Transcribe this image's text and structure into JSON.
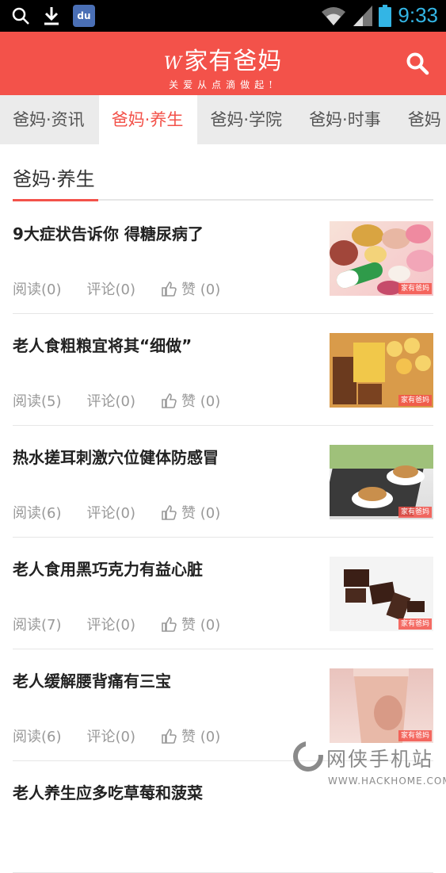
{
  "status_bar": {
    "time": "9:33",
    "left_icons": [
      "search-icon",
      "download-icon",
      "baidu-app-icon"
    ],
    "baidu_label": "du",
    "right_icons": [
      "wifi-icon",
      "signal-icon",
      "battery-icon"
    ],
    "time_color": "#33b5e5"
  },
  "header": {
    "brand_prefix": "W",
    "brand_name": "家有爸妈",
    "slogan": "关爱从点滴做起!",
    "background_color": "#f3524a",
    "search_icon": "search-icon"
  },
  "tabs": [
    {
      "label": "爸妈·资讯",
      "active": false
    },
    {
      "label": "爸妈·养生",
      "active": true
    },
    {
      "label": "爸妈·学院",
      "active": false
    },
    {
      "label": "爸妈·时事",
      "active": false
    },
    {
      "label": "爸妈",
      "active": false
    }
  ],
  "section": {
    "title": "爸妈·养生"
  },
  "articles": [
    {
      "title": "9大症状告诉你 得糖尿病了",
      "reads": "阅读(0)",
      "comments": "评论(0)",
      "likes": "赞 (0)",
      "thumb_watermark": "家有爸妈"
    },
    {
      "title": "老人食粗粮宜将其“细做”",
      "reads": "阅读(5)",
      "comments": "评论(0)",
      "likes": "赞 (0)",
      "thumb_watermark": "家有爸妈"
    },
    {
      "title": "热水搓耳刺激穴位健体防感冒",
      "reads": "阅读(6)",
      "comments": "评论(0)",
      "likes": "赞 (0)",
      "thumb_watermark": "家有爸妈"
    },
    {
      "title": "老人食用黑巧克力有益心脏",
      "reads": "阅读(7)",
      "comments": "评论(0)",
      "likes": "赞 (0)",
      "thumb_watermark": "家有爸妈"
    },
    {
      "title": "老人缓解腰背痛有三宝",
      "reads": "阅读(6)",
      "comments": "评论(0)",
      "likes": "赞 (0)",
      "thumb_watermark": "家有爸妈"
    },
    {
      "title": "老人养生应多吃草莓和菠菜",
      "reads": "",
      "comments": "",
      "likes": "",
      "thumb_watermark": ""
    }
  ],
  "site_watermark": {
    "text": "网侠手机站",
    "url": "WWW.HACKHOME.COM"
  }
}
